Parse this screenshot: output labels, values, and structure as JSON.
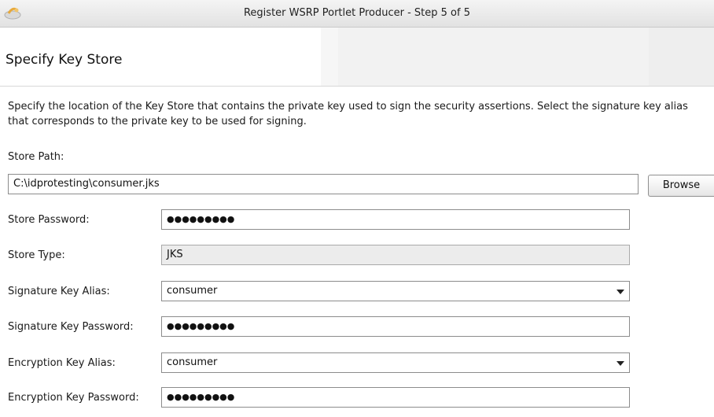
{
  "window": {
    "title": "Register WSRP Portlet Producer - Step 5 of 5"
  },
  "page": {
    "title": "Specify Key Store",
    "description": "Specify the location of the Key Store that contains the private key used to sign the security assertions. Select the signature key alias that corresponds to the private key to be used for signing."
  },
  "form": {
    "store_path": {
      "label": "Store Path:",
      "value": "C:\\idprotesting\\consumer.jks"
    },
    "browse_label": "Browse",
    "store_password": {
      "label": "Store Password:",
      "value": "●●●●●●●●●"
    },
    "store_type": {
      "label": "Store Type:",
      "value": "JKS"
    },
    "signature_key_alias": {
      "label": "Signature Key Alias:",
      "value": "consumer"
    },
    "signature_key_password": {
      "label": "Signature Key Password:",
      "value": "●●●●●●●●●"
    },
    "encryption_key_alias": {
      "label": "Encryption Key Alias:",
      "value": "consumer"
    },
    "encryption_key_password": {
      "label": "Encryption Key Password:",
      "value": "●●●●●●●●●"
    }
  }
}
